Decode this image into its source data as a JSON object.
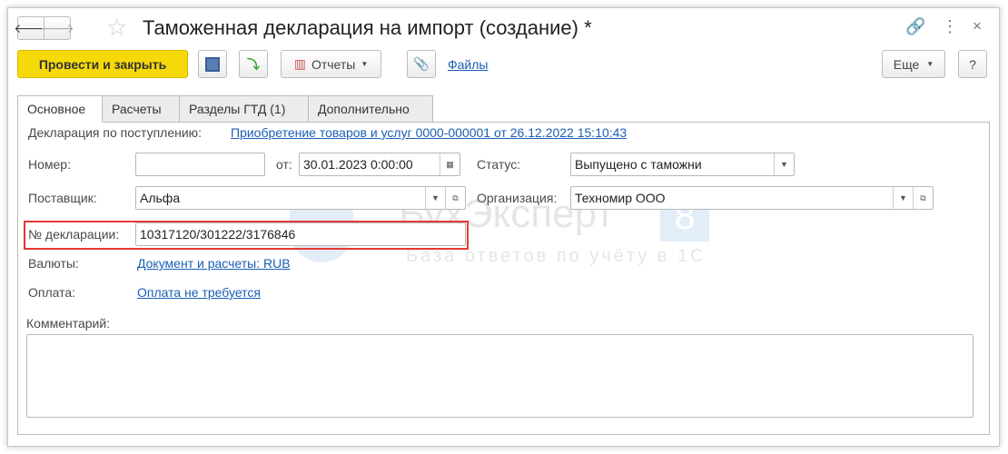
{
  "header": {
    "title": "Таможенная декларация на импорт (создание) *"
  },
  "toolbar": {
    "post_close": "Провести и закрыть",
    "reports": "Отчеты",
    "files": "Файлы",
    "more": "Еще",
    "help": "?"
  },
  "tabs": [
    {
      "label": "Основное",
      "active": true
    },
    {
      "label": "Расчеты"
    },
    {
      "label": "Разделы ГТД (1)"
    },
    {
      "label": "Дополнительно"
    }
  ],
  "form": {
    "basis_label": "Декларация по поступлению:",
    "basis_link": "Приобретение товаров и услуг 0000-000001 от 26.12.2022 15:10:43",
    "number_label": "Номер:",
    "number_value": "",
    "date_label": "от:",
    "date_value": "30.01.2023  0:00:00",
    "status_label": "Статус:",
    "status_value": "Выпущено с таможни",
    "supplier_label": "Поставщик:",
    "supplier_value": "Альфа",
    "org_label": "Организация:",
    "org_value": "Техномир ООО",
    "decl_label": "№ декларации:",
    "decl_value": "10317120/301222/3176846",
    "currency_label": "Валюты:",
    "currency_link": "Документ и расчеты: RUB",
    "payment_label": "Оплата:",
    "payment_link": "Оплата не требуется",
    "comment_label": "Комментарий:",
    "comment_value": ""
  },
  "watermark": {
    "title": "БухЭксперт",
    "badge": "8",
    "subtitle": "База ответов по учёту в 1С"
  },
  "colors": {
    "primary_button": "#f5d90a",
    "link": "#1a5fb4",
    "highlight": "#e53935"
  }
}
